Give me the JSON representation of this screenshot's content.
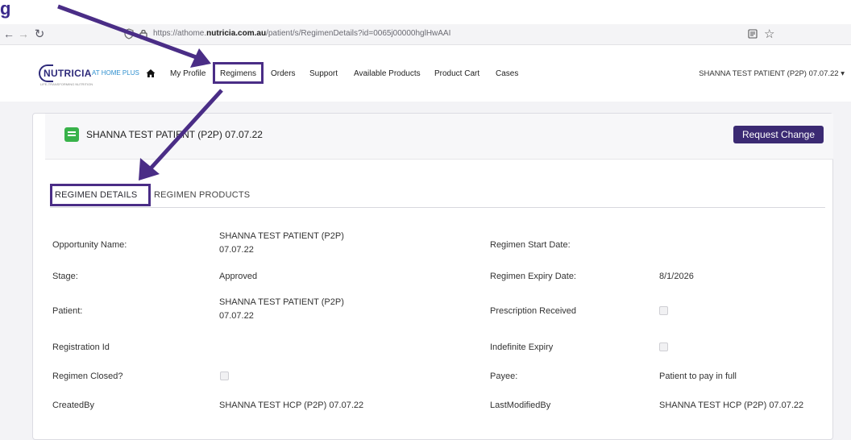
{
  "annotation": {
    "corner_text": "g"
  },
  "browser": {
    "url_prefix": "https://athome.",
    "url_domain": "nutricia.com.au",
    "url_rest": "/patient/s/RegimenDetails?id=0065j00000hglHwAAI",
    "icons": [
      "back-icon",
      "forward-icon",
      "reload-icon",
      "shield-icon",
      "lock-icon",
      "reader-icon",
      "star-icon"
    ]
  },
  "app": {
    "brand": "NUTRICIA",
    "brand_suffix": "AT HOME PLUS",
    "tagline": "LIFE-TRANSFORMING NUTRITION",
    "nav": [
      "My Profile",
      "Regimens",
      "Orders",
      "Support",
      "Available Products",
      "Product Cart",
      "Cases"
    ],
    "user_label": "SHANNA TEST PATIENT (P2P) 07.07.22"
  },
  "record": {
    "title": "SHANNA TEST PATIENT (P2P) 07.07.22",
    "request_change_label": "Request Change"
  },
  "tabs": [
    "REGIMEN DETAILS",
    "REGIMEN PRODUCTS"
  ],
  "details": {
    "left": [
      {
        "label": "Opportunity Name:",
        "value": "SHANNA TEST PATIENT (P2P)",
        "value2": "07.07.22"
      },
      {
        "label": "Stage:",
        "value": "Approved"
      },
      {
        "label": "Patient:",
        "value": "SHANNA TEST PATIENT (P2P)",
        "value2": "07.07.22"
      },
      {
        "label": "Registration Id",
        "value": ""
      },
      {
        "label": "Regimen Closed?",
        "checkbox": false
      },
      {
        "label": "CreatedBy",
        "value": "SHANNA TEST HCP (P2P) 07.07.22"
      }
    ],
    "right": [
      {
        "label": "Regimen Start Date:",
        "value": ""
      },
      {
        "label": "Regimen Expiry Date:",
        "value": "8/1/2026"
      },
      {
        "label": "Prescription Received",
        "checkbox": false
      },
      {
        "label": "Indefinite Expiry",
        "checkbox": false
      },
      {
        "label": "Payee:",
        "value": "Patient to pay in full"
      },
      {
        "label": "LastModifiedBy",
        "value": "SHANNA TEST HCP (P2P) 07.07.22"
      }
    ]
  },
  "colors": {
    "accent": "#3b2a73",
    "annotation": "#4a2d86",
    "record_icon": "#38b24a"
  }
}
